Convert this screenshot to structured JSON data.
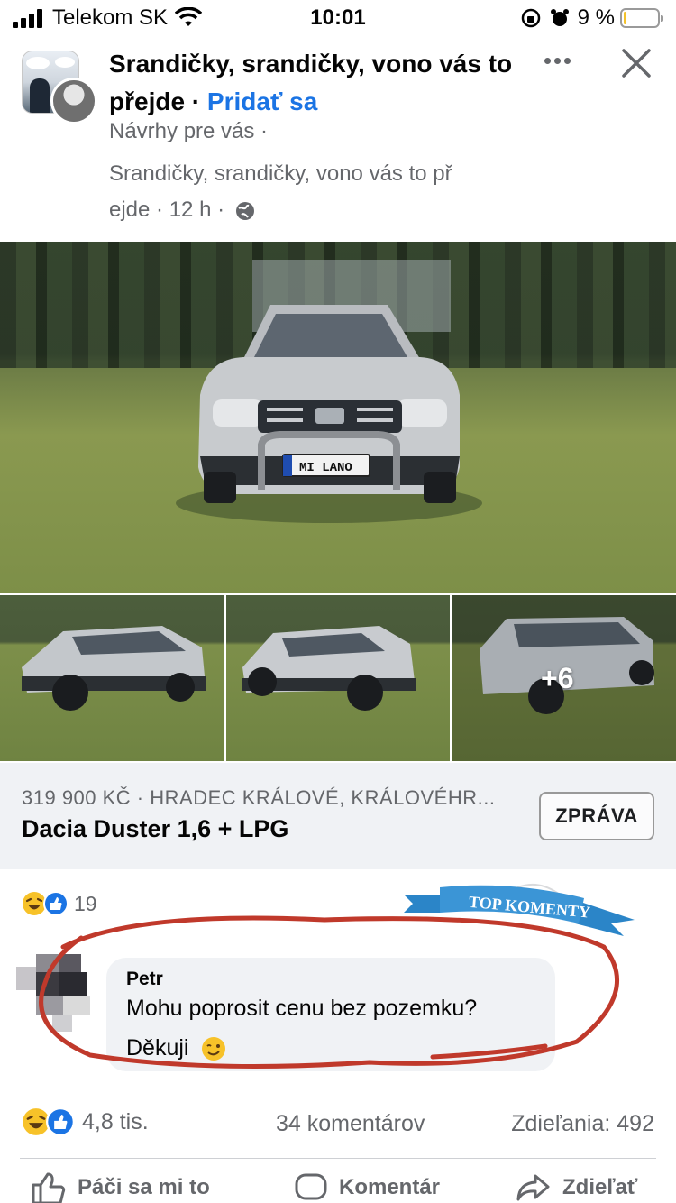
{
  "status_bar": {
    "carrier": "Telekom SK",
    "time": "10:01",
    "battery_percent": "9 %",
    "battery_level": 0.09
  },
  "post": {
    "group_title": "Srandičky, srandičky, vono vás to přejde",
    "separator": " · ",
    "join_label": "Pridať sa",
    "suggestion": "Návrhy pre vás ·",
    "group_name_line1": "Srandičky, srandičky, vono vás to př",
    "group_name_line2": "ejde",
    "age": " · 12 h · "
  },
  "photos": {
    "plate_text": "MI LANO",
    "more_count": "+6"
  },
  "listing": {
    "meta": "319 900 KČ · HRADEC KRÁLOVÉ, KRÁLOVÉHR...",
    "title": "Dacia Duster 1,6 + LPG",
    "message_button": "ZPRÁVA"
  },
  "top_comment": {
    "badge": "TOP KOMENTY",
    "reaction_count": "19",
    "author": "Petr",
    "line1": "Mohu poprosit cenu bez pozemku?",
    "line2": "Děkuji"
  },
  "stats": {
    "reactions": "4,8 tis.",
    "comments": "34 komentárov",
    "shares": "Zdieľania: 492"
  },
  "actions": {
    "like": "Páči sa mi to",
    "comment": "Komentár",
    "share": "Zdieľať"
  },
  "colors": {
    "link_blue": "#1b74e4",
    "secondary_text": "#65676b",
    "highlight_red": "#c0392b"
  }
}
